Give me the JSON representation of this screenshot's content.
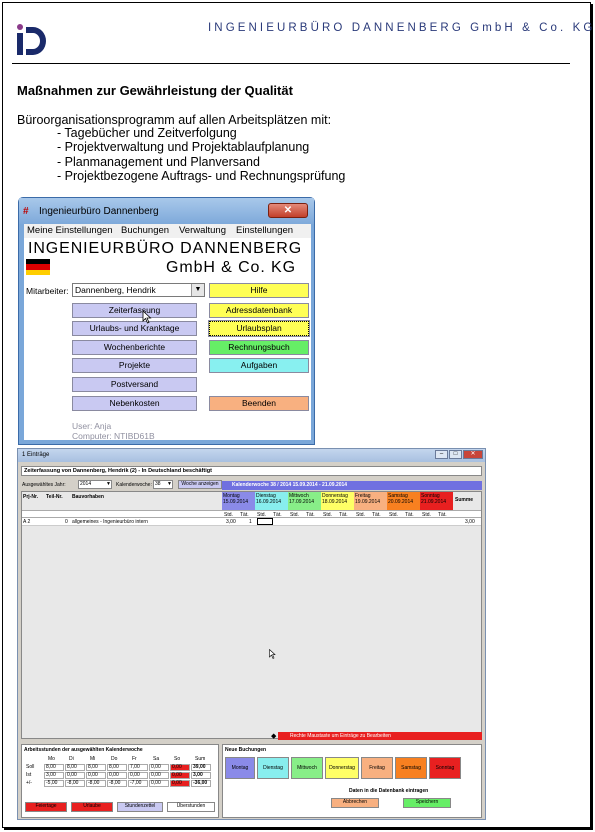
{
  "header": {
    "company": "INGENIEURBÜRO DANNENBERG GmbH & Co. KG"
  },
  "document": {
    "title": "Maßnahmen zur Gewährleistung der Qualität",
    "intro": "Büroorganisationsprogramm auf allen Arbeitsplätzen mit:",
    "bullets": [
      "- Tagebücher und Zeitverfolgung",
      "- Projektverwaltung und Projektablaufplanung",
      "- Planmanagement und Planversand",
      "- Projektbezogene Auftrags- und Rechnungsprüfung"
    ]
  },
  "app": {
    "window_title": "Ingenieurbüro Dannenberg",
    "menu": [
      "Meine Einstellungen",
      "Buchungen",
      "Verwaltung",
      "Einstellungen"
    ],
    "brand_line1": "INGENIEURBÜRO DANNENBERG",
    "brand_line2": "GmbH & Co. KG",
    "employee_label": "Mitarbeiter:",
    "employee_value": "Dannenberg, Hendrik",
    "left_buttons": [
      "Zeiterfassung",
      "Urlaubs- und Kranktage",
      "Wochenberichte",
      "Projekte",
      "Postversand",
      "Nebenkosten"
    ],
    "right_buttons": [
      "Hilfe",
      "Adressdatenbank",
      "Urlaubsplan",
      "Rechnungsbuch",
      "Aufgaben",
      "Beenden"
    ],
    "user": "User: Anja",
    "computer": "Computer: NTIBD61B"
  },
  "timesheet": {
    "window_title": "1 Einträge",
    "header": "Zeiterfassung von Dannenberg, Hendrik (2) - In Deutschland beschäftigt",
    "year_label": "Ausgewähltes Jahr:",
    "year": "2014",
    "week_label": "Kalenderwoche:",
    "week": "38",
    "show_week_button": "Woche anzeigen",
    "week_banner": "Kalenderwoche 38 / 2014     15.09.2014 - 21.09.2014",
    "col_headers": [
      "Prj-Nr.",
      "Teil-Nr.",
      "Bauvorhaben"
    ],
    "days": [
      {
        "name": "Montag",
        "date": "15.09.2014",
        "color": "#8a8ae8"
      },
      {
        "name": "Dienstag",
        "date": "16.09.2014",
        "color": "#88eeee"
      },
      {
        "name": "Mittwoch",
        "date": "17.09.2014",
        "color": "#88ee88"
      },
      {
        "name": "Donnerstag",
        "date": "18.09.2014",
        "color": "#ffff66"
      },
      {
        "name": "Freitag",
        "date": "19.09.2014",
        "color": "#f8b080"
      },
      {
        "name": "Samstag",
        "date": "20.09.2014",
        "color": "#f88020"
      },
      {
        "name": "Sonntag",
        "date": "21.09.2014",
        "color": "#e82020"
      }
    ],
    "sum_label": "Summe",
    "std_label": "Std.",
    "tat_label": "Tät.",
    "row": {
      "prj": "A 2",
      "teil": "0",
      "bau": "allgemeines - Ingenieurbüro intern",
      "std": "3,00",
      "tat": "1",
      "sum": "3,00"
    },
    "hint": "Rechte Maustaste um Einträge zu Bearbeiten",
    "hours_title": "Arbeitsstunden der ausgewählten Kalenderwoche",
    "hours_cols": [
      "Mo",
      "Di",
      "Mi",
      "Do",
      "Fr",
      "Sa",
      "So",
      "Sum"
    ],
    "hours_rows": [
      {
        "label": "Soll",
        "values": [
          "8,00",
          "8,00",
          "8,00",
          "8,00",
          "7,00",
          "0,00",
          "0,00",
          "39,00"
        ]
      },
      {
        "label": "Ist",
        "values": [
          "3,00",
          "0,00",
          "0,00",
          "0,00",
          "0,00",
          "0,00",
          "0,00",
          "3,00"
        ]
      },
      {
        "label": "+/-",
        "values": [
          "-5,00",
          "-8,00",
          "-8,00",
          "-8,00",
          "-7,00",
          "0,00",
          "0,00",
          "-36,00"
        ]
      }
    ],
    "bottom_buttons": [
      "Feiertage",
      "Urlaube",
      "Stundenzettel",
      "Überstunden"
    ],
    "new_title": "Neue Buchungen",
    "new_buttons": [
      "Montag",
      "Dienstag",
      "Mittwoch",
      "Donnerstag",
      "Freitag",
      "Samstag",
      "Sonntag"
    ],
    "db_label": "Daten in die Datenbank eintragen",
    "cancel": "Abbrechen",
    "save": "Speichern"
  }
}
